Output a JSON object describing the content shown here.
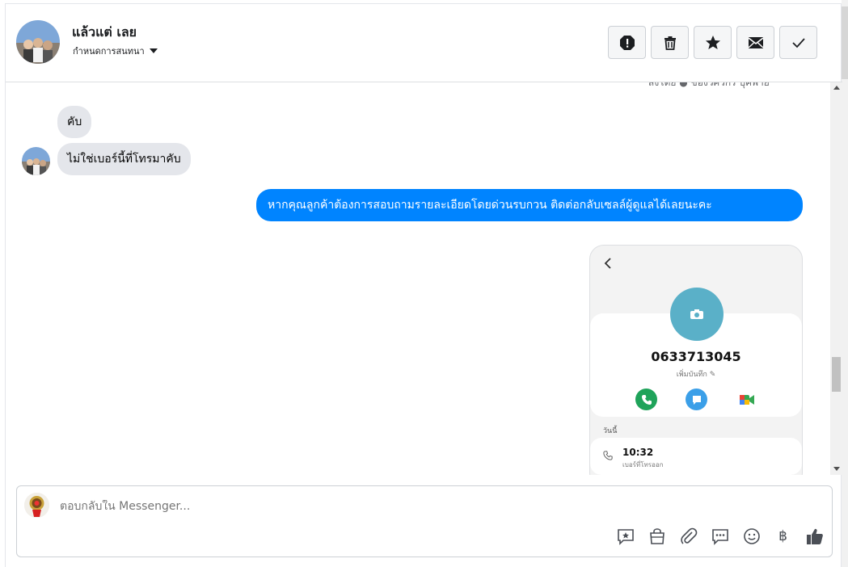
{
  "header": {
    "contact_name": "แล้วแต่ เลย",
    "assign_label": "กำหนดการสนทนา",
    "actions": [
      {
        "icon": "alert-icon"
      },
      {
        "icon": "trash-icon"
      },
      {
        "icon": "star-icon"
      },
      {
        "icon": "mail-icon"
      },
      {
        "icon": "check-icon"
      }
    ]
  },
  "conversation": {
    "meta_text": "ส่งโดย ● ของวิศวกร บุคพาย",
    "incoming": [
      "คับ",
      "ไม่ใช่เบอร์นี้ที่โทรมาคับ"
    ],
    "outgoing": "หากคุณลูกค้าต้องการสอบถามรายละเอียดโดยด่วนรบกวน ติดต่อกลับเซลล์ผู้ดูแลได้เลยนะคะ",
    "attachment": {
      "phone_number": "0633713045",
      "note_label": "เพิ่มบันทึก",
      "today_label": "วันนี้",
      "call_time": "10:32",
      "call_type": "เบอร์ที่โทรออก"
    }
  },
  "composer": {
    "placeholder": "ตอบกลับใน Messenger...",
    "tools": [
      "saved-reply-icon",
      "shop-bag-icon",
      "attach-icon",
      "chat-options-icon",
      "emoji-icon",
      "baht-icon",
      "like-icon"
    ],
    "baht_symbol": "฿"
  },
  "colors": {
    "accent": "#1877f2",
    "outgoing_bubble": "#0084ff",
    "incoming_bubble": "#e4e6eb"
  }
}
